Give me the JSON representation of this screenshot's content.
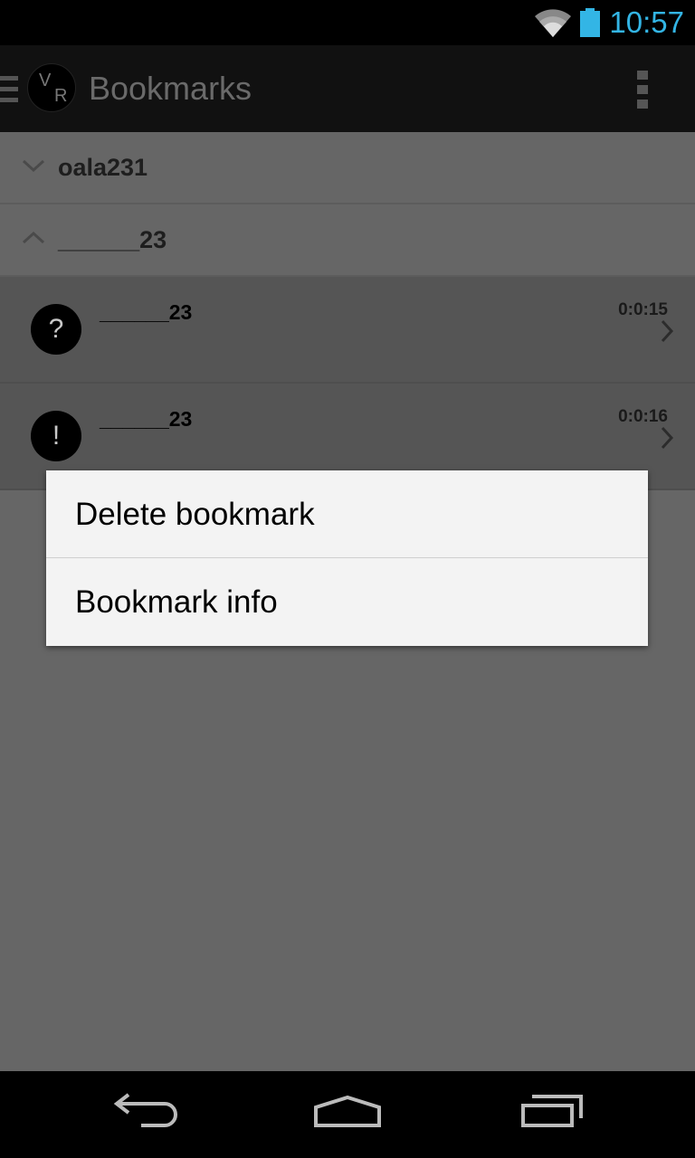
{
  "status_bar": {
    "time": "10:57",
    "icons": [
      "wifi-icon",
      "battery-icon"
    ],
    "accent_color": "#33b5e5"
  },
  "action_bar": {
    "logo_letters": [
      "V",
      "R"
    ],
    "title": "Bookmarks",
    "icons": [
      "drawer-icon",
      "overflow-menu-icon"
    ]
  },
  "groups": [
    {
      "label": "oala231",
      "expanded": false,
      "icon": "chevron-down-icon"
    },
    {
      "label": "______23",
      "expanded": true,
      "icon": "chevron-up-icon"
    }
  ],
  "bookmarks": [
    {
      "badge": "?",
      "name": "______23",
      "time": "0:0:15",
      "icon": "chevron-right-icon"
    },
    {
      "badge": "!",
      "name": "______23",
      "time": "0:0:16",
      "icon": "chevron-right-icon"
    }
  ],
  "context_menu": {
    "items": [
      {
        "label": "Delete bookmark"
      },
      {
        "label": "Bookmark info"
      }
    ]
  },
  "nav_bar": {
    "icons": [
      "back-icon",
      "home-icon",
      "recent-apps-icon"
    ]
  }
}
